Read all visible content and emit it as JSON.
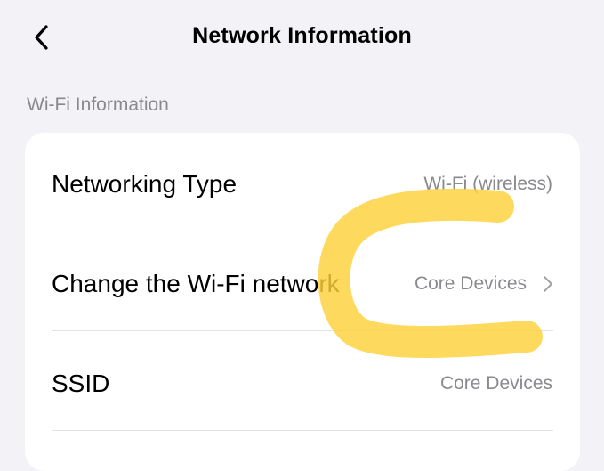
{
  "nav": {
    "title": "Network Information",
    "back_icon": "chevron-left-icon"
  },
  "section": {
    "header": "Wi-Fi Information"
  },
  "rows": [
    {
      "label": "Networking Type",
      "value": "Wi-Fi (wireless)",
      "chevron": false
    },
    {
      "label": "Change the Wi-Fi network",
      "value": "Core Devices",
      "chevron": true
    },
    {
      "label": "SSID",
      "value": "Core Devices",
      "chevron": false
    }
  ],
  "colors": {
    "background": "#f2f2f7",
    "card": "#ffffff",
    "secondary_text": "#8a8a8e",
    "highlight_stroke": "#fcd23a"
  }
}
